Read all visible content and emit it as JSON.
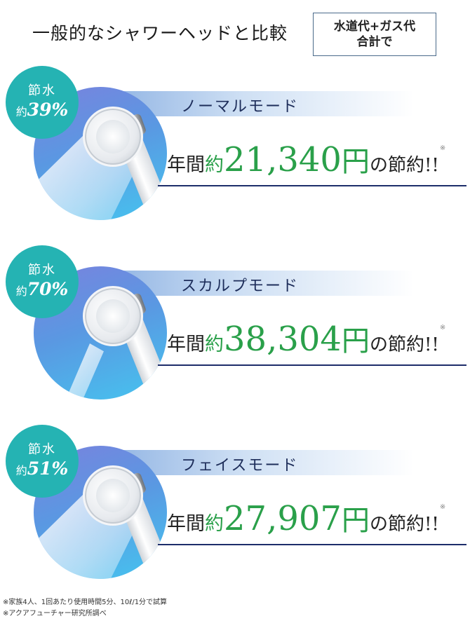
{
  "header": {
    "title": "一般的なシャワーヘッドと比較",
    "box_line1": "水道代+ガス代",
    "box_line2": "合計で"
  },
  "sections": [
    {
      "badge_top": "節水",
      "badge_prefix": "約",
      "badge_value": "39%",
      "mode": "ノーマルモード",
      "prefix1": "年間",
      "prefix2": "約",
      "amount": "21,340",
      "yen": "円",
      "suffix": "の節約!!",
      "note_mark": "※"
    },
    {
      "badge_top": "節水",
      "badge_prefix": "約",
      "badge_value": "70%",
      "mode": "スカルプモード",
      "prefix1": "年間",
      "prefix2": "約",
      "amount": "38,304",
      "yen": "円",
      "suffix": "の節約!!",
      "note_mark": "※"
    },
    {
      "badge_top": "節水",
      "badge_prefix": "約",
      "badge_value": "51%",
      "mode": "フェイスモード",
      "prefix1": "年間",
      "prefix2": "約",
      "amount": "27,907",
      "yen": "円",
      "suffix": "の節約!!",
      "note_mark": "※"
    }
  ],
  "footnotes": [
    "※家族4人、1回あたり使用時間5分、10ℓ/1分で試算",
    "※アクアフューチャー研究所調べ"
  ],
  "colors": {
    "badge": "#25b3b3",
    "green": "#2aa04a",
    "navy": "#1d2d6a"
  }
}
